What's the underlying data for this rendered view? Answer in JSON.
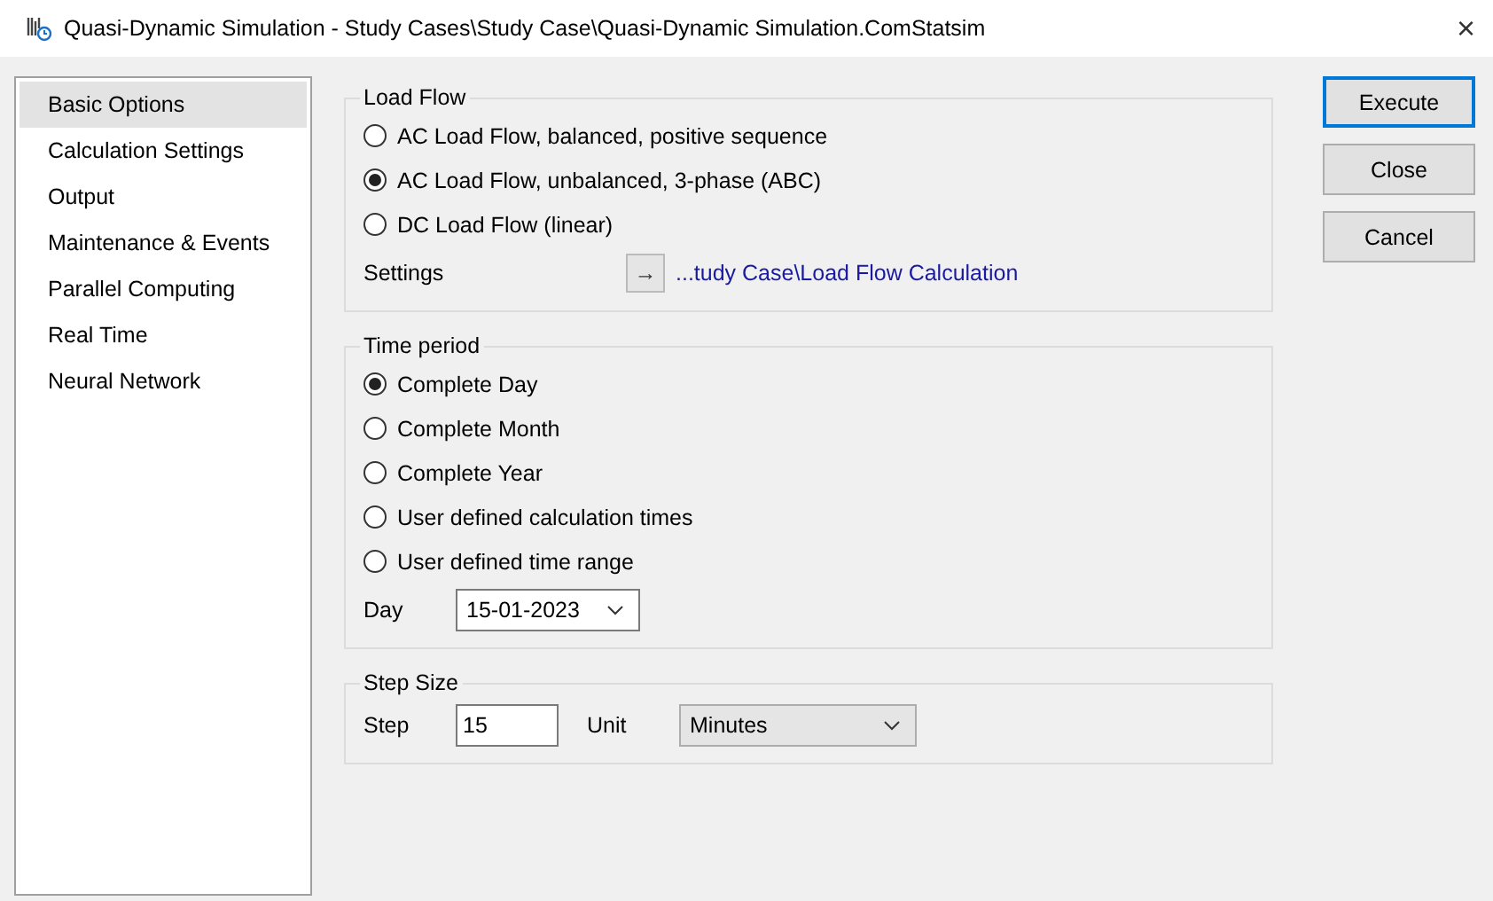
{
  "window": {
    "title": "Quasi-Dynamic Simulation - Study Cases\\Study Case\\Quasi-Dynamic Simulation.ComStatsim",
    "close": "×"
  },
  "sidebar": {
    "items": [
      {
        "label": "Basic Options",
        "selected": true
      },
      {
        "label": "Calculation Settings",
        "selected": false
      },
      {
        "label": "Output",
        "selected": false
      },
      {
        "label": "Maintenance & Events",
        "selected": false
      },
      {
        "label": "Parallel Computing",
        "selected": false
      },
      {
        "label": "Real Time",
        "selected": false
      },
      {
        "label": "Neural Network",
        "selected": false
      }
    ]
  },
  "load_flow": {
    "title": "Load Flow",
    "options": [
      {
        "label": "AC Load Flow, balanced, positive sequence",
        "selected": false
      },
      {
        "label": "AC Load Flow, unbalanced, 3-phase (ABC)",
        "selected": true
      },
      {
        "label": "DC Load Flow (linear)",
        "selected": false
      }
    ],
    "settings_label": "Settings",
    "settings_arrow": "→",
    "settings_link": "...tudy Case\\Load Flow Calculation"
  },
  "time_period": {
    "title": "Time period",
    "options": [
      {
        "label": "Complete Day",
        "selected": true
      },
      {
        "label": "Complete Month",
        "selected": false
      },
      {
        "label": "Complete Year",
        "selected": false
      },
      {
        "label": "User defined calculation times",
        "selected": false
      },
      {
        "label": "User defined time range",
        "selected": false
      }
    ],
    "day_label": "Day",
    "day_value": "15-01-2023"
  },
  "step_size": {
    "title": "Step Size",
    "step_label": "Step",
    "step_value": "15",
    "unit_label": "Unit",
    "unit_value": "Minutes"
  },
  "buttons": [
    {
      "label": "Execute",
      "default": true
    },
    {
      "label": "Close",
      "default": false
    },
    {
      "label": "Cancel",
      "default": false
    }
  ]
}
